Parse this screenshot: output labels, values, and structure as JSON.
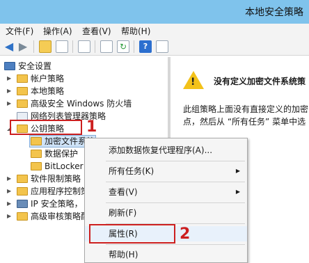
{
  "window": {
    "title": "本地安全策略"
  },
  "menu": {
    "file": "文件(F)",
    "action": "操作(A)",
    "view": "查看(V)",
    "help": "帮助(H)"
  },
  "tree": {
    "root": "安全设置",
    "items": [
      "帐户策略",
      "本地策略",
      "高级安全 Windows 防火墙",
      "网络列表管理器策略",
      "公钥策略",
      "加密文件系统",
      "数据保护",
      "BitLocker",
      "软件限制策略",
      "应用程序控制策",
      "IP 安全策略，",
      "高级审核策略配"
    ]
  },
  "details": {
    "title": "没有定义加密文件系统策",
    "body_line1": "此组策略上面没有直接定义的加密",
    "body_line2": "点，然后从 “所有任务” 菜单中选"
  },
  "context_menu": {
    "add_agent": "添加数据恢复代理程序(A)...",
    "all_tasks": "所有任务(K)",
    "view": "查看(V)",
    "refresh": "刷新(F)",
    "properties": "属性(R)",
    "help": "帮助(H)"
  },
  "annotations": {
    "step1": "1",
    "step2": "2"
  },
  "colors": {
    "title_bar": "#7fc3ec",
    "highlight_red": "#cc1f1f",
    "folder": "#f3c44c",
    "selection": "#cfe3f7"
  },
  "icons": [
    "back-arrow-icon",
    "forward-arrow-icon",
    "folder-up-icon",
    "console-tree-icon",
    "properties-icon",
    "export-icon",
    "refresh-icon",
    "help-icon",
    "warning-icon"
  ]
}
